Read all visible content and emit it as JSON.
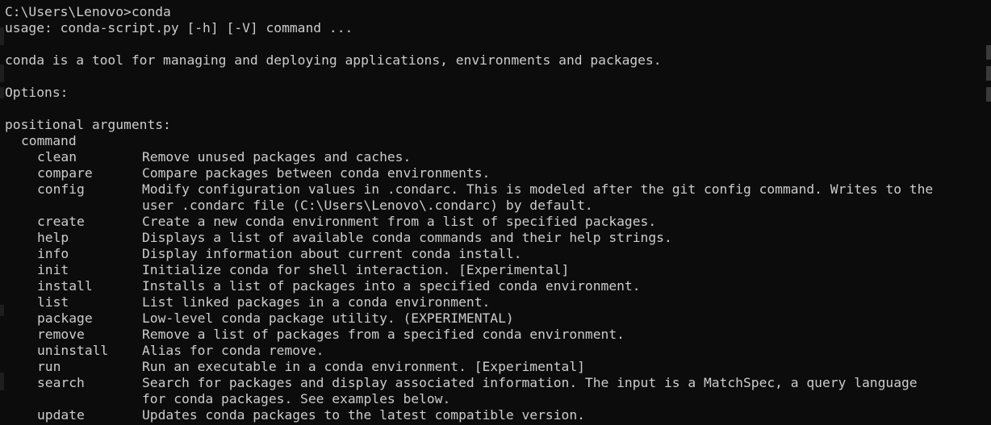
{
  "window": {
    "theme": {
      "background": "#0c0c0c",
      "foreground": "#cccccc"
    }
  },
  "console": {
    "prompt_line": "C:\\Users\\Lenovo>conda",
    "usage": "usage: conda-script.py [-h] [-V] command ...",
    "description": "conda is a tool for managing and deploying applications, environments and packages.",
    "options_heading": "Options:",
    "positional_heading": "positional arguments:",
    "command_heading": "command",
    "commands": [
      {
        "name": "clean",
        "desc": "Remove unused packages and caches."
      },
      {
        "name": "compare",
        "desc": "Compare packages between conda environments."
      },
      {
        "name": "config",
        "desc": "Modify configuration values in .condarc. This is modeled after the git config command. Writes to the",
        "cont": "user .condarc file (C:\\Users\\Lenovo\\.condarc) by default."
      },
      {
        "name": "create",
        "desc": "Create a new conda environment from a list of specified packages."
      },
      {
        "name": "help",
        "desc": "Displays a list of available conda commands and their help strings."
      },
      {
        "name": "info",
        "desc": "Display information about current conda install."
      },
      {
        "name": "init",
        "desc": "Initialize conda for shell interaction. [Experimental]"
      },
      {
        "name": "install",
        "desc": "Installs a list of packages into a specified conda environment."
      },
      {
        "name": "list",
        "desc": "List linked packages in a conda environment."
      },
      {
        "name": "package",
        "desc": "Low-level conda package utility. (EXPERIMENTAL)"
      },
      {
        "name": "remove",
        "desc": "Remove a list of packages from a specified conda environment."
      },
      {
        "name": "uninstall",
        "desc": "Alias for conda remove."
      },
      {
        "name": "run",
        "desc": "Run an executable in a conda environment. [Experimental]"
      },
      {
        "name": "search",
        "desc": "Search for packages and display associated information. The input is a MatchSpec, a query language",
        "cont": "for conda packages. See examples below."
      },
      {
        "name": "update",
        "desc": "Updates conda packages to the latest compatible version."
      }
    ]
  }
}
